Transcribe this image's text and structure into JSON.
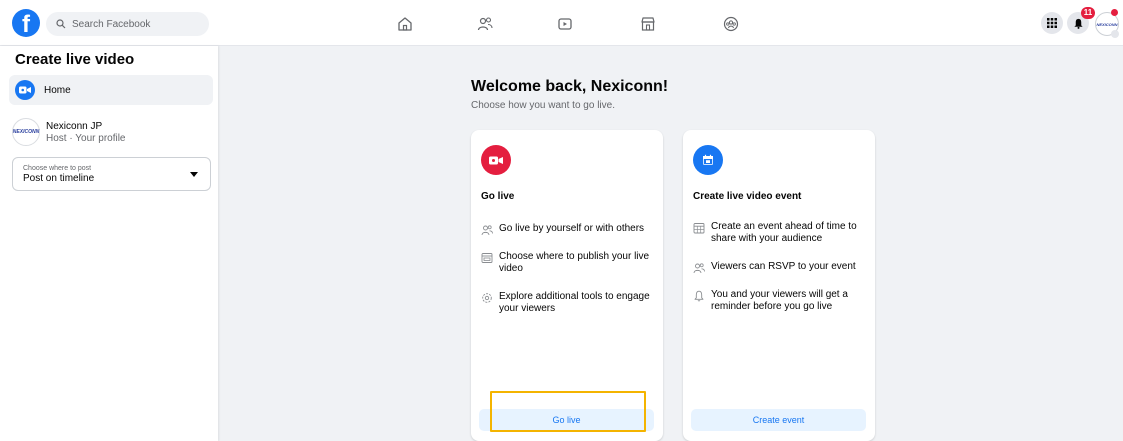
{
  "header": {
    "search_placeholder": "Search Facebook",
    "notification_count": "11",
    "avatar_logo": "NEXICONN"
  },
  "sidebar": {
    "title": "Create live video",
    "home_label": "Home",
    "profile": {
      "name": "Nexiconn JP",
      "subtitle": "Host · Your profile",
      "logo": "NEXICONN"
    },
    "select": {
      "label": "Choose where to post",
      "value": "Post on timeline"
    }
  },
  "main": {
    "welcome": "Welcome back, Nexiconn!",
    "subtitle": "Choose how you want to go live.",
    "cards": [
      {
        "title": "Go live",
        "features": [
          "Go live by yourself or with others",
          "Choose where to publish your live video",
          "Explore additional tools to engage your viewers"
        ],
        "button": "Go live"
      },
      {
        "title": "Create live video event",
        "features": [
          "Create an event ahead of time to share with your audience",
          "Viewers can RSVP to your event",
          "You and your viewers will get a reminder before you go live"
        ],
        "button": "Create event"
      }
    ]
  },
  "colors": {
    "brand": "#1877f2",
    "live_red": "#e41e3f",
    "highlight": "#f4b400"
  }
}
